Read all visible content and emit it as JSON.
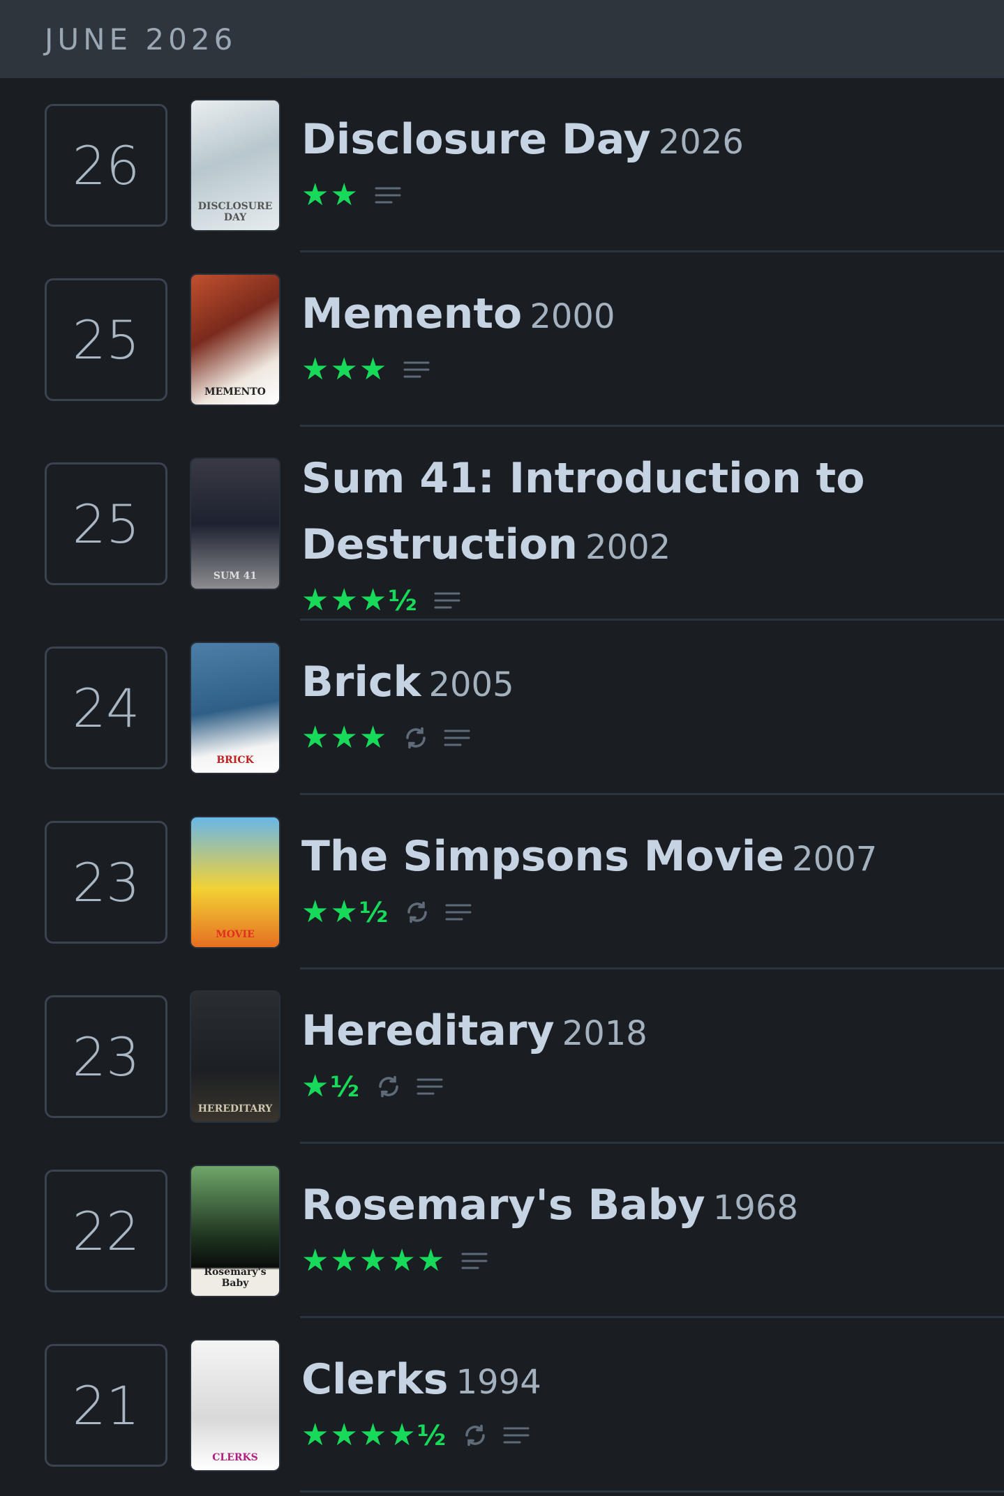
{
  "month_label": "JUNE 2026",
  "entries": [
    {
      "day": "26",
      "title": "Disclosure Day",
      "year": "2026",
      "stars": "★★",
      "half": "",
      "rewatch": false,
      "poster_text": "DISCLOSURE DAY"
    },
    {
      "day": "25",
      "title": "Memento",
      "year": "2000",
      "stars": "★★★",
      "half": "",
      "rewatch": false,
      "poster_text": "MEMENTO"
    },
    {
      "day": "25",
      "title": "Sum 41: Introduction to Destruction",
      "year": "2002",
      "stars": "★★★",
      "half": "½",
      "rewatch": false,
      "poster_text": "SUM 41"
    },
    {
      "day": "24",
      "title": "Brick",
      "year": "2005",
      "stars": "★★★",
      "half": "",
      "rewatch": true,
      "poster_text": "BRICK"
    },
    {
      "day": "23",
      "title": "The Simpsons Movie",
      "year": "2007",
      "stars": "★★",
      "half": "½",
      "rewatch": true,
      "poster_text": "MOVIE"
    },
    {
      "day": "23",
      "title": "Hereditary",
      "year": "2018",
      "stars": "★",
      "half": "½",
      "rewatch": true,
      "poster_text": "HEREDITARY"
    },
    {
      "day": "22",
      "title": "Rosemary's Baby",
      "year": "1968",
      "stars": "★★★★★",
      "half": "",
      "rewatch": false,
      "poster_text": "Rosemary's Baby"
    },
    {
      "day": "21",
      "title": "Clerks",
      "year": "1994",
      "stars": "★★★★",
      "half": "½",
      "rewatch": true,
      "poster_text": "CLERKS"
    }
  ],
  "colors": {
    "star": "#17d95a",
    "background": "#1a1d22",
    "header": "#2f353d"
  }
}
